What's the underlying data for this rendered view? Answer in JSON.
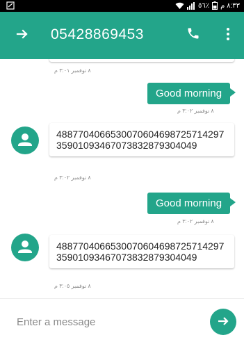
{
  "status_bar": {
    "notification_icon": "notification-icon",
    "wifi_icon": "wifi-icon",
    "signal_icon": "signal-icon",
    "battery_percent_text": "٥٦٪",
    "battery_icon": "battery-icon",
    "time": "٨:٣٣ م"
  },
  "header": {
    "back_icon": "arrow-right-icon",
    "phone_number": "05428869453",
    "call_icon": "phone-icon",
    "menu_icon": "more-vert-icon"
  },
  "messages": [
    {
      "direction": "in",
      "text": "",
      "timestamp": "٨ نوفمبر ٣:٠١ م",
      "partial": true
    },
    {
      "direction": "out",
      "text": "Good morning",
      "timestamp": "٨ نوفمبر ٣:٠٢ م"
    },
    {
      "direction": "in",
      "text": "488770406653007060469872571429735901093467073832879304049",
      "timestamp": "٨ نوفمبر ٣:٠٢ م"
    },
    {
      "direction": "out",
      "text": "Good morning",
      "timestamp": "٨ نوفمبر ٣:٠٢ م"
    },
    {
      "direction": "in",
      "text": "488770406653007060469872571429735901093467073832879304049",
      "timestamp": "٨ نوفمبر ٣:٠٥ م"
    }
  ],
  "composer": {
    "placeholder": "Enter a message",
    "value": "",
    "send_icon": "send-arrow-icon"
  },
  "colors": {
    "accent": "#23a58a",
    "status_bar": "#000000"
  }
}
